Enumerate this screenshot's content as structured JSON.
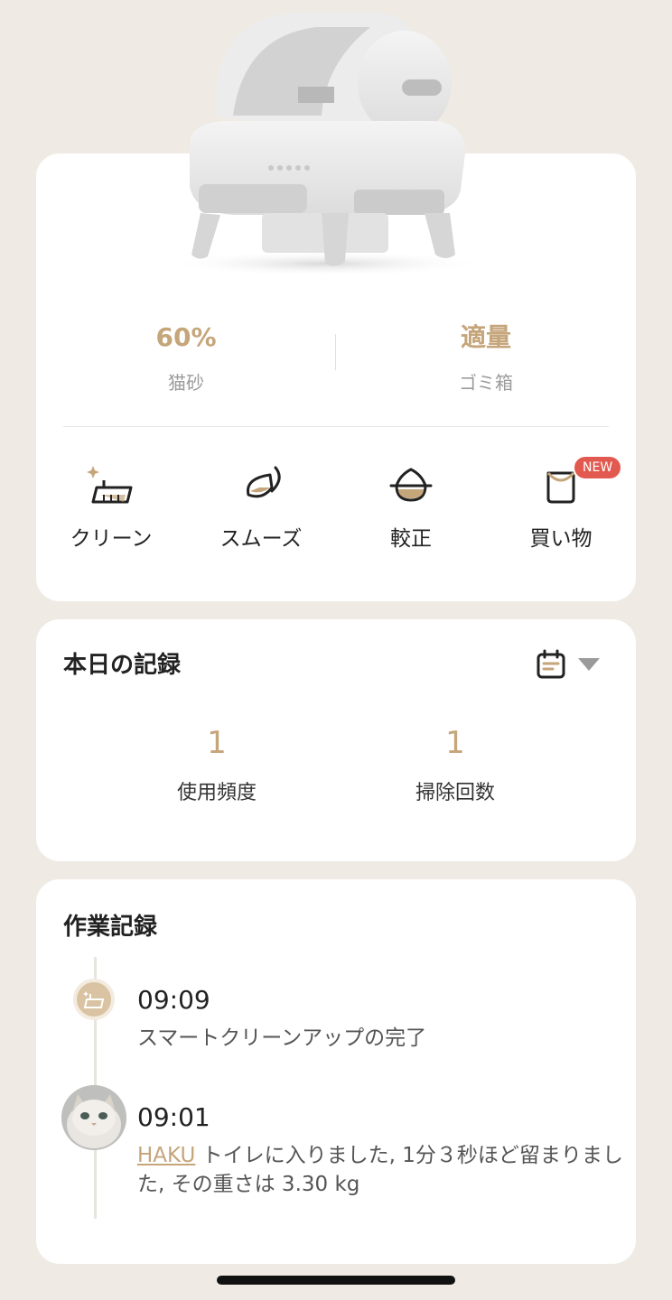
{
  "device": {
    "litter_level": "60%",
    "litter_label": "猫砂",
    "bin_status": "適量",
    "bin_label": "ゴミ箱"
  },
  "actions": [
    {
      "label": "クリーン",
      "icon": "broom-icon"
    },
    {
      "label": "スムーズ",
      "icon": "smooth-icon"
    },
    {
      "label": "較正",
      "icon": "calibrate-icon"
    },
    {
      "label": "買い物",
      "icon": "shopping-bag-icon",
      "badge": "NEW"
    }
  ],
  "today": {
    "title": "本日の記録",
    "usage_count": "1",
    "usage_label": "使用頻度",
    "clean_count": "1",
    "clean_label": "掃除回数"
  },
  "log": {
    "title": "作業記録",
    "entries": [
      {
        "time": "09:09",
        "text": "スマートクリーンアップの完了",
        "icon": "broom-icon"
      },
      {
        "time": "09:01",
        "cat_name": "HAKU",
        "text": " トイレに入りました, 1分３秒ほど留まりました, その重さは 3.30 kg",
        "icon": "cat-avatar"
      }
    ]
  },
  "colors": {
    "accent": "#c5a57a",
    "badge": "#e25a4f",
    "background": "#efebe4"
  }
}
